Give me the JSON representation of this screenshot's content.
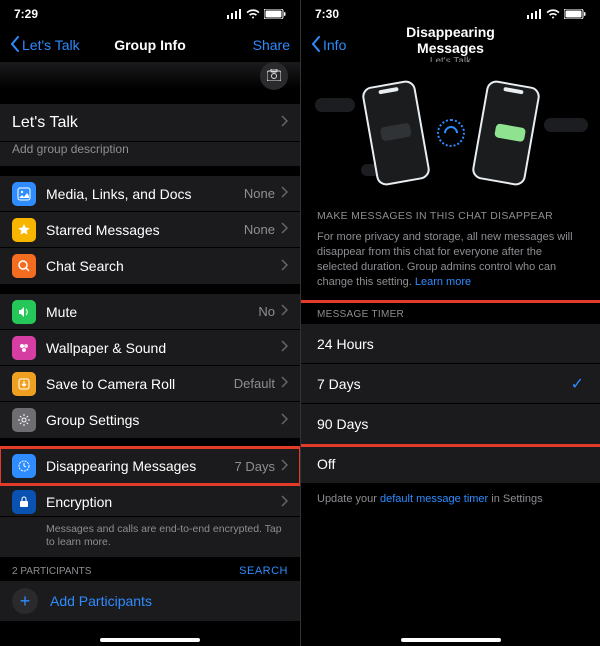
{
  "left": {
    "status_time": "7:29",
    "nav_back": "Let's Talk",
    "nav_title": "Group Info",
    "nav_share": "Share",
    "group_name": "Let's Talk",
    "add_desc": "Add group description",
    "rows": {
      "media": {
        "label": "Media, Links, and Docs",
        "value": "None"
      },
      "starred": {
        "label": "Starred Messages",
        "value": "None"
      },
      "search": {
        "label": "Chat Search"
      },
      "mute": {
        "label": "Mute",
        "value": "No"
      },
      "wallpaper": {
        "label": "Wallpaper & Sound"
      },
      "camera": {
        "label": "Save to Camera Roll",
        "value": "Default"
      },
      "settings": {
        "label": "Group Settings"
      },
      "disappearing": {
        "label": "Disappearing Messages",
        "value": "7 Days"
      },
      "encryption": {
        "label": "Encryption",
        "sub": "Messages and calls are end-to-end encrypted. Tap to learn more."
      }
    },
    "participants_hdr": "2 PARTICIPANTS",
    "search_link": "SEARCH",
    "add_participants": "Add Participants"
  },
  "right": {
    "status_time": "7:30",
    "nav_back": "Info",
    "nav_title": "Disappearing Messages",
    "nav_subtitle": "Let's Talk",
    "desc_hdr": "MAKE MESSAGES IN THIS CHAT DISAPPEAR",
    "desc_body": "For more privacy and storage, all new messages will disappear from this chat for everyone after the selected duration. Group admins control who can change this setting. ",
    "learn_more": "Learn more",
    "timer_hdr": "MESSAGE TIMER",
    "options": {
      "o1": "24 Hours",
      "o2": "7 Days",
      "o3": "90 Days",
      "off": "Off"
    },
    "selected": "7 Days",
    "foot_pre": "Update your ",
    "foot_link": "default message timer",
    "foot_post": " in Settings"
  }
}
